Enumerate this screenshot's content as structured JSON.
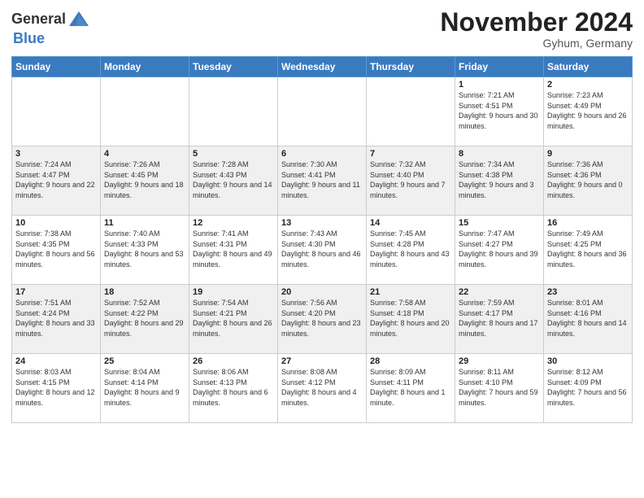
{
  "header": {
    "logo_general": "General",
    "logo_blue": "Blue",
    "month_title": "November 2024",
    "location": "Gyhum, Germany"
  },
  "weekdays": [
    "Sunday",
    "Monday",
    "Tuesday",
    "Wednesday",
    "Thursday",
    "Friday",
    "Saturday"
  ],
  "weeks": [
    [
      {
        "day": "",
        "info": ""
      },
      {
        "day": "",
        "info": ""
      },
      {
        "day": "",
        "info": ""
      },
      {
        "day": "",
        "info": ""
      },
      {
        "day": "",
        "info": ""
      },
      {
        "day": "1",
        "info": "Sunrise: 7:21 AM\nSunset: 4:51 PM\nDaylight: 9 hours and 30 minutes."
      },
      {
        "day": "2",
        "info": "Sunrise: 7:23 AM\nSunset: 4:49 PM\nDaylight: 9 hours and 26 minutes."
      }
    ],
    [
      {
        "day": "3",
        "info": "Sunrise: 7:24 AM\nSunset: 4:47 PM\nDaylight: 9 hours and 22 minutes."
      },
      {
        "day": "4",
        "info": "Sunrise: 7:26 AM\nSunset: 4:45 PM\nDaylight: 9 hours and 18 minutes."
      },
      {
        "day": "5",
        "info": "Sunrise: 7:28 AM\nSunset: 4:43 PM\nDaylight: 9 hours and 14 minutes."
      },
      {
        "day": "6",
        "info": "Sunrise: 7:30 AM\nSunset: 4:41 PM\nDaylight: 9 hours and 11 minutes."
      },
      {
        "day": "7",
        "info": "Sunrise: 7:32 AM\nSunset: 4:40 PM\nDaylight: 9 hours and 7 minutes."
      },
      {
        "day": "8",
        "info": "Sunrise: 7:34 AM\nSunset: 4:38 PM\nDaylight: 9 hours and 3 minutes."
      },
      {
        "day": "9",
        "info": "Sunrise: 7:36 AM\nSunset: 4:36 PM\nDaylight: 9 hours and 0 minutes."
      }
    ],
    [
      {
        "day": "10",
        "info": "Sunrise: 7:38 AM\nSunset: 4:35 PM\nDaylight: 8 hours and 56 minutes."
      },
      {
        "day": "11",
        "info": "Sunrise: 7:40 AM\nSunset: 4:33 PM\nDaylight: 8 hours and 53 minutes."
      },
      {
        "day": "12",
        "info": "Sunrise: 7:41 AM\nSunset: 4:31 PM\nDaylight: 8 hours and 49 minutes."
      },
      {
        "day": "13",
        "info": "Sunrise: 7:43 AM\nSunset: 4:30 PM\nDaylight: 8 hours and 46 minutes."
      },
      {
        "day": "14",
        "info": "Sunrise: 7:45 AM\nSunset: 4:28 PM\nDaylight: 8 hours and 43 minutes."
      },
      {
        "day": "15",
        "info": "Sunrise: 7:47 AM\nSunset: 4:27 PM\nDaylight: 8 hours and 39 minutes."
      },
      {
        "day": "16",
        "info": "Sunrise: 7:49 AM\nSunset: 4:25 PM\nDaylight: 8 hours and 36 minutes."
      }
    ],
    [
      {
        "day": "17",
        "info": "Sunrise: 7:51 AM\nSunset: 4:24 PM\nDaylight: 8 hours and 33 minutes."
      },
      {
        "day": "18",
        "info": "Sunrise: 7:52 AM\nSunset: 4:22 PM\nDaylight: 8 hours and 29 minutes."
      },
      {
        "day": "19",
        "info": "Sunrise: 7:54 AM\nSunset: 4:21 PM\nDaylight: 8 hours and 26 minutes."
      },
      {
        "day": "20",
        "info": "Sunrise: 7:56 AM\nSunset: 4:20 PM\nDaylight: 8 hours and 23 minutes."
      },
      {
        "day": "21",
        "info": "Sunrise: 7:58 AM\nSunset: 4:18 PM\nDaylight: 8 hours and 20 minutes."
      },
      {
        "day": "22",
        "info": "Sunrise: 7:59 AM\nSunset: 4:17 PM\nDaylight: 8 hours and 17 minutes."
      },
      {
        "day": "23",
        "info": "Sunrise: 8:01 AM\nSunset: 4:16 PM\nDaylight: 8 hours and 14 minutes."
      }
    ],
    [
      {
        "day": "24",
        "info": "Sunrise: 8:03 AM\nSunset: 4:15 PM\nDaylight: 8 hours and 12 minutes."
      },
      {
        "day": "25",
        "info": "Sunrise: 8:04 AM\nSunset: 4:14 PM\nDaylight: 8 hours and 9 minutes."
      },
      {
        "day": "26",
        "info": "Sunrise: 8:06 AM\nSunset: 4:13 PM\nDaylight: 8 hours and 6 minutes."
      },
      {
        "day": "27",
        "info": "Sunrise: 8:08 AM\nSunset: 4:12 PM\nDaylight: 8 hours and 4 minutes."
      },
      {
        "day": "28",
        "info": "Sunrise: 8:09 AM\nSunset: 4:11 PM\nDaylight: 8 hours and 1 minute."
      },
      {
        "day": "29",
        "info": "Sunrise: 8:11 AM\nSunset: 4:10 PM\nDaylight: 7 hours and 59 minutes."
      },
      {
        "day": "30",
        "info": "Sunrise: 8:12 AM\nSunset: 4:09 PM\nDaylight: 7 hours and 56 minutes."
      }
    ]
  ]
}
